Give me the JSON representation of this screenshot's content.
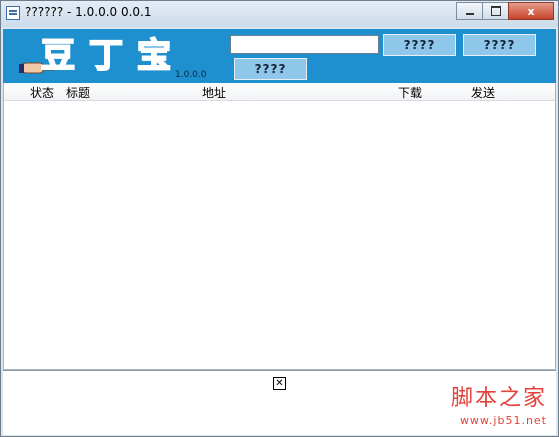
{
  "window": {
    "title": "?????? - 1.0.0.0 0.0.1",
    "minimize_label": "",
    "maximize_label": "",
    "close_label": "x"
  },
  "header": {
    "logo_text": "豆丁宝",
    "version": "1.0.0.0",
    "url_input_value": "",
    "button_1": "????",
    "button_2": "????",
    "button_3": "????"
  },
  "list": {
    "columns": [
      "状态",
      "标题",
      "地址",
      "下载",
      "发送"
    ],
    "rows": []
  },
  "bottom_panel": {
    "close_icon": "close-box-icon",
    "close_glyph": "✕"
  },
  "watermark": {
    "chinese": "脚本之家",
    "url": "www.jb51.net"
  },
  "colors": {
    "header_bg": "#1e8fcf",
    "button_bg": "#8ec7ea",
    "watermark": "#e3413a"
  }
}
